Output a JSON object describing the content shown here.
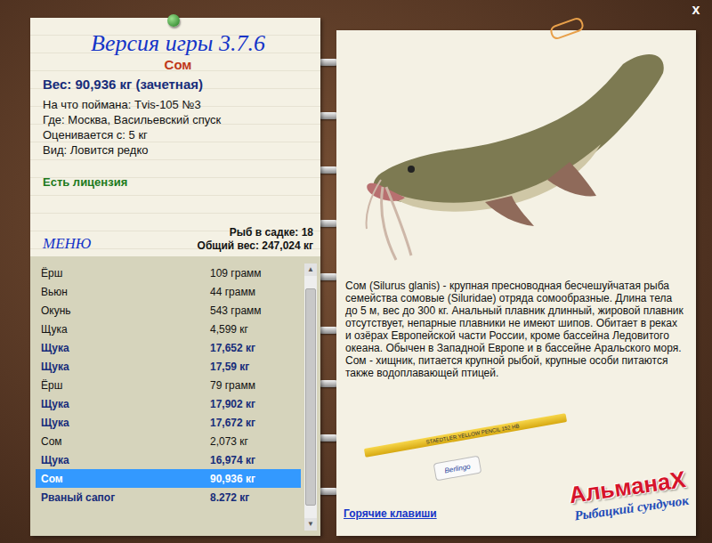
{
  "window": {
    "close": "x"
  },
  "info": {
    "version_title": "Версия игры 3.7.6",
    "fish_name": "Сом",
    "weight": "Вес: 90,936 кг (зачетная)",
    "details": [
      "На что поймана: Tvis-105 №3",
      "Где: Москва, Васильевский спуск",
      "Оценивается с: 5 кг",
      "Вид: Ловится редко"
    ],
    "license": "Есть лицензия",
    "menu": "МЕНЮ",
    "fish_count": "Рыб в садке: 18",
    "total_weight": "Общий вес: 247,024 кг"
  },
  "catch_list": {
    "rows": [
      {
        "name": "Ёрш",
        "weight": "109 грамм",
        "trophy": false,
        "selected": false
      },
      {
        "name": "Вьюн",
        "weight": "44 грамм",
        "trophy": false,
        "selected": false
      },
      {
        "name": "Окунь",
        "weight": "543 грамм",
        "trophy": false,
        "selected": false
      },
      {
        "name": "Щука",
        "weight": "4,599 кг",
        "trophy": false,
        "selected": false
      },
      {
        "name": "Щука",
        "weight": "17,652 кг",
        "trophy": true,
        "selected": false
      },
      {
        "name": "Щука",
        "weight": "17,59 кг",
        "trophy": true,
        "selected": false
      },
      {
        "name": "Ёрш",
        "weight": "79 грамм",
        "trophy": false,
        "selected": false
      },
      {
        "name": "Щука",
        "weight": "17,902 кг",
        "trophy": true,
        "selected": false
      },
      {
        "name": "Щука",
        "weight": "17,672 кг",
        "trophy": true,
        "selected": false
      },
      {
        "name": "Сом",
        "weight": "2,073 кг",
        "trophy": false,
        "selected": false
      },
      {
        "name": "Щука",
        "weight": "16,974 кг",
        "trophy": true,
        "selected": false
      },
      {
        "name": "Сом",
        "weight": "90,936 кг",
        "trophy": true,
        "selected": true
      },
      {
        "name": "Рваный сапог",
        "weight": "8.272 кг",
        "trophy": true,
        "selected": false
      }
    ],
    "scrollbar": {
      "up": "▲",
      "down": "▼",
      "level": 0.9
    }
  },
  "description": "Сом (Silurus glanis) - крупная пресноводная бесчешуйчатая рыба семейства сомовые (Siluridae) отряда сомообразные. Длина тела до 5 м, вес до 300 кг. Анальный плавник длинный, жировой плавник отсутствует, непарные плавники не имеют шипов. Обитает в реках и озёрах Европейской части России, кроме бассейна Ледовитого океана. Обычен в Западной Европе и в бассейне Аральского моря. Сом - хищник, питается крупной рыбой, крупные особи питаются также водоплавающей птицей.",
  "hotkeys_link": "Горячие клавиши",
  "pencil_label": "STAEDTLER YELLOW PENCIL 152 HB",
  "eraser_label": "Berlingo",
  "logo": {
    "title": "АльманаХ",
    "subtitle": "Рыбацкий сундучок"
  }
}
